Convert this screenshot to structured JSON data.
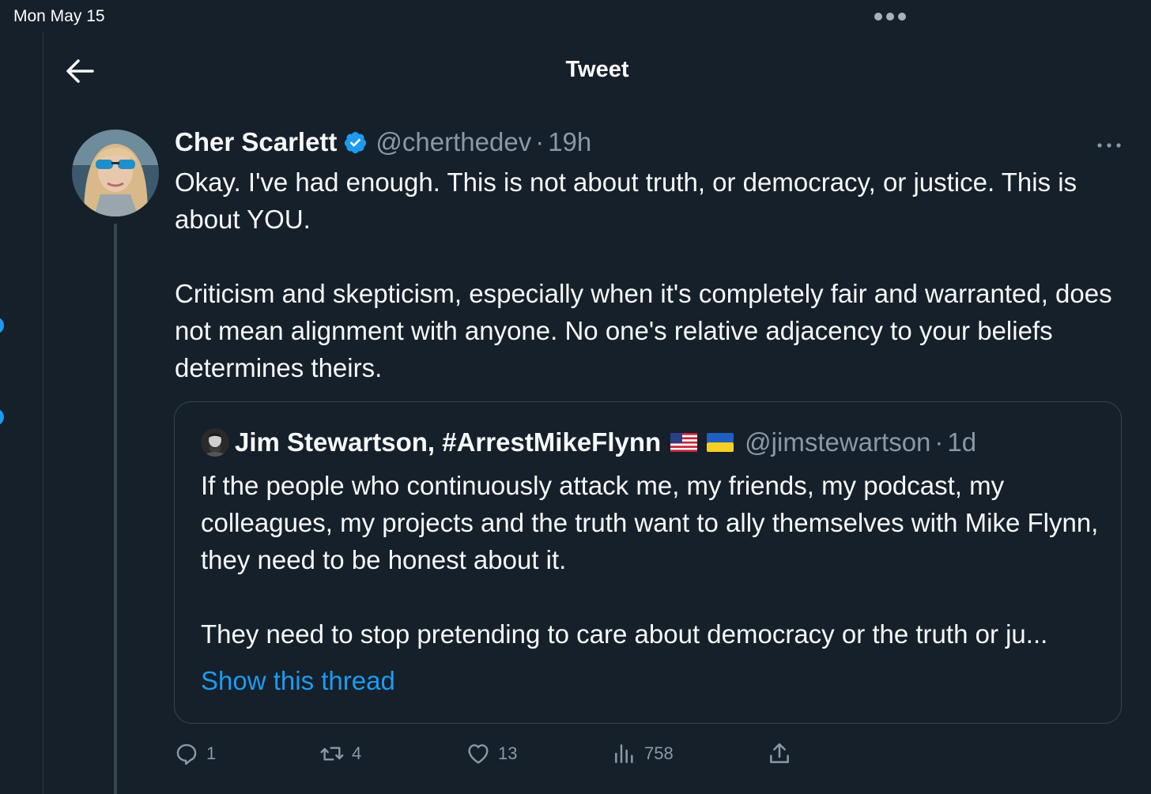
{
  "status_bar": {
    "time": "Mon May 15"
  },
  "header": {
    "title": "Tweet"
  },
  "tweet": {
    "author": {
      "name": "Cher Scarlett",
      "handle": "@cherthedev",
      "time": "19h",
      "separator": "·"
    },
    "paragraphs": [
      "Okay. I've had enough.  This is not about truth, or democracy,  or justice. This is about YOU.",
      "Criticism and skepticism, especially when it's completely fair and warranted, does not mean alignment with anyone. No one's relative adjacency to your beliefs determines theirs."
    ],
    "quote": {
      "author": {
        "name": "Jim Stewartson, #ArrestMikeFlynn",
        "handle": "@jimstewartson",
        "time": "1d",
        "separator": "·"
      },
      "paragraphs": [
        "If the people who continuously attack me, my friends, my podcast, my colleagues, my projects and the truth want to ally themselves with Mike Flynn, they need to be honest about it.",
        "They need to stop pretending to care about democracy or the truth or ju..."
      ],
      "show_thread": "Show this thread"
    },
    "actions": {
      "replies": "1",
      "retweets": "4",
      "likes": "13",
      "views": "758"
    }
  },
  "colors": {
    "background": "#15202b",
    "accent": "#1d9bf0",
    "muted": "#8b98a5",
    "border": "#38444d"
  },
  "icons": [
    "back-arrow-icon",
    "verified-badge-icon",
    "more-icon",
    "reply-icon",
    "retweet-icon",
    "like-icon",
    "views-icon",
    "share-icon",
    "us-flag-icon",
    "ukraine-flag-icon"
  ]
}
